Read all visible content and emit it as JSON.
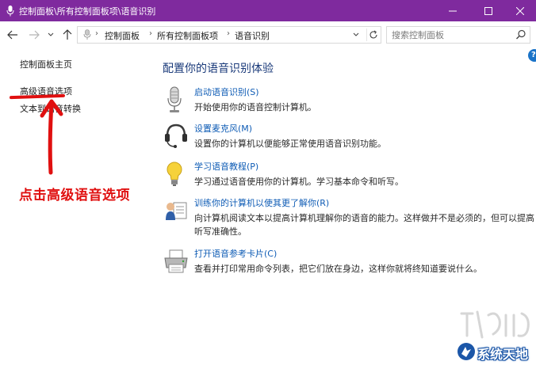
{
  "window": {
    "title": "控制面板\\所有控制面板项\\语音识别"
  },
  "address_bar": {
    "crumbs": [
      "控制面板",
      "所有控制面板项",
      "语音识别"
    ]
  },
  "search": {
    "placeholder": "搜索控制面板"
  },
  "help": {
    "label": "?"
  },
  "left_nav": {
    "home": "控制面板主页",
    "advanced": "高级语音选项",
    "tts": "文本到语音转换"
  },
  "annotation": {
    "text": "点击高级语音选项",
    "color": "#e01010"
  },
  "main": {
    "heading": "配置你的语音识别体验",
    "tasks": [
      {
        "icon": "microphone-icon",
        "link": "启动语音识别(S)",
        "desc": "开始使用你的语音控制计算机。"
      },
      {
        "icon": "headset-icon",
        "link": "设置麦克风(M)",
        "desc": "设置你的计算机以便能够正常使用语音识别功能。"
      },
      {
        "icon": "lightbulb-icon",
        "link": "学习语音教程(P)",
        "desc": "学习通过语音使用你的计算机。学习基本命令和听写。"
      },
      {
        "icon": "user-document-icon",
        "link": "训练你的计算机以使其更了解你(R)",
        "desc": "向计算机阅读文本以提高计算机理解你的语音的能力。这样做并不是必须的，但可以提高听写准确性。"
      },
      {
        "icon": "printer-icon",
        "link": "打开语音参考卡片(C)",
        "desc": "查看并打印常用命令列表，把它们放在身边，这样你就将终知道要说什么。"
      }
    ]
  },
  "watermark": {
    "text": "系统天地"
  },
  "colors": {
    "titlebar": "#7f2a9e",
    "link": "#0f5cb5",
    "heading": "#1a3a7a"
  }
}
